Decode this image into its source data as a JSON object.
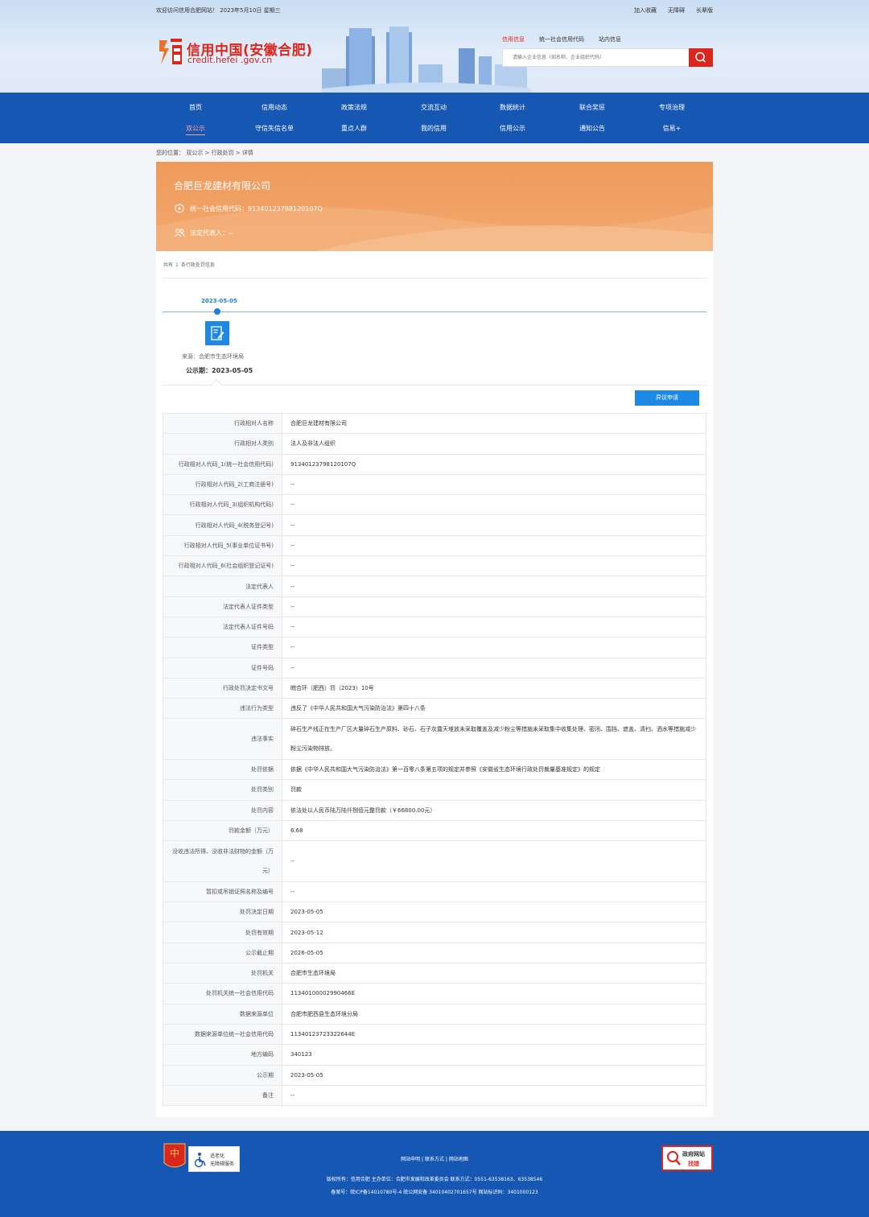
{
  "topbar": {
    "welcome": "欢迎访问信用合肥网站！ 2023年5月10日 星期三",
    "links": [
      "加入收藏",
      "无障碍",
      "长辈版"
    ]
  },
  "logo": {
    "title": "信用中国(安徽合肥)",
    "subtitle": "credit.hefei .gov.cn"
  },
  "search": {
    "tabs": [
      "信用信息",
      "统一社会信用代码",
      "站内信息"
    ],
    "placeholder": "请输入企业信息（如名称、企业组织代码）"
  },
  "nav": {
    "row1": [
      "首页",
      "信用动态",
      "政策法规",
      "交流互动",
      "数据统计",
      "联合奖惩",
      "专项治理"
    ],
    "row2": [
      "双公示",
      "守信失信名单",
      "重点人群",
      "我的信用",
      "信用公示",
      "通知公告",
      "信易+"
    ]
  },
  "breadcrumb": {
    "prefix": "您的位置：",
    "items": [
      "双公示",
      "行政处罚",
      "详情"
    ],
    "sep": " > "
  },
  "company": {
    "name": "合肥巨龙建材有限公司",
    "credit_code": "统一社会信用代码：91340123798120107Q",
    "legal_rep": "法定代表人：--"
  },
  "records": {
    "prefix": "共有",
    "count": "1",
    "suffix": "条行政处罚信息"
  },
  "timeline": {
    "date": "2023-05-05",
    "source": "来源：合肥市生态环境局",
    "pub_date": "公示期：2023-05-05"
  },
  "objection_button": "异议申请",
  "table": [
    {
      "label": "行政相对人名称",
      "value": "合肥巨龙建材有限公司"
    },
    {
      "label": "行政相对人类别",
      "value": "法人及非法人组织"
    },
    {
      "label": "行政相对人代码_1(统一社会信用代码)",
      "value": "91340123798120107Q"
    },
    {
      "label": "行政相对人代码_2(工商注册号)",
      "value": "--"
    },
    {
      "label": "行政相对人代码_3(组织机构代码)",
      "value": "--"
    },
    {
      "label": "行政相对人代码_4(税务登记号)",
      "value": "--"
    },
    {
      "label": "行政相对人代码_5(事业单位证书号)",
      "value": "--"
    },
    {
      "label": "行政相对人代码_6(社会组织登记证号)",
      "value": "--"
    },
    {
      "label": "法定代表人",
      "value": "--"
    },
    {
      "label": "法定代表人证件类型",
      "value": "--"
    },
    {
      "label": "法定代表人证件号码",
      "value": "--"
    },
    {
      "label": "证件类型",
      "value": "--"
    },
    {
      "label": "证件号码",
      "value": "--"
    },
    {
      "label": "行政处罚决定书文号",
      "value": "皖合环（肥西）罚（2023）10号"
    },
    {
      "label": "违法行为类型",
      "value": "违反了《中华人民共和国大气污染防治法》第四十八条"
    },
    {
      "label": "违法事实",
      "value": "碎石生产线正在生产厂区大量碎石生产原料、砂石、石子灰露天堆放未采取覆盖及减少粉尘等措施未采取集中收集处理、密闭、围挡、遮盖、清扫、洒水等措施减少粉尘污染物排放。"
    },
    {
      "label": "处罚依据",
      "value": "依据《中华人民共和国大气污染防治法》第一百零八条第五项的规定并参照《安徽省生态环境行政处罚裁量基准规定》的规定"
    },
    {
      "label": "处罚类别",
      "value": "罚款"
    },
    {
      "label": "处罚内容",
      "value": "依法处以人民币陆万陆仟捌佰元整罚款（￥66800.00元）"
    },
    {
      "label": "罚款金额（万元）",
      "value": "6.68"
    },
    {
      "label": "没收违法所得、没收非法财物的金额（万元）",
      "value": "--"
    },
    {
      "label": "暂扣或吊销证照名称及编号",
      "value": "--"
    },
    {
      "label": "处罚决定日期",
      "value": "2023-05-05"
    },
    {
      "label": "处罚有效期",
      "value": "2023-05-12"
    },
    {
      "label": "公示截止期",
      "value": "2026-05-05"
    },
    {
      "label": "处罚机关",
      "value": "合肥市生态环境局"
    },
    {
      "label": "处罚机关统一社会信用代码",
      "value": "11340100002990466E"
    },
    {
      "label": "数据来源单位",
      "value": "合肥市肥西县生态环境分局"
    },
    {
      "label": "数据来源单位统一社会信用代码",
      "value": "11340123723322644E"
    },
    {
      "label": "地方编码",
      "value": "340123"
    },
    {
      "label": "公示期",
      "value": "2023-05-05"
    },
    {
      "label": "备注",
      "value": "--"
    }
  ],
  "footer": {
    "badge_text1": "适老化",
    "badge_text2": "无障碍服务",
    "links": [
      "网站申明",
      "联系方式",
      "网站地图"
    ],
    "link_sep": " | ",
    "line1": "版权所有：信用合肥   主办单位：合肥市发展和改革委员会   联系方式：0551-63538163、63538546",
    "line2": "备案号：皖ICP备14010780号-4     皖公网安备 34010402701657号     网站标识码：3401000123",
    "gov_line1": "政府网站",
    "gov_line2": "找错"
  },
  "colors": {
    "brand_red": "#d9271d",
    "nav_blue": "#1757b4",
    "accent_blue": "#1e88e5",
    "banner_orange": "#f0a060"
  }
}
